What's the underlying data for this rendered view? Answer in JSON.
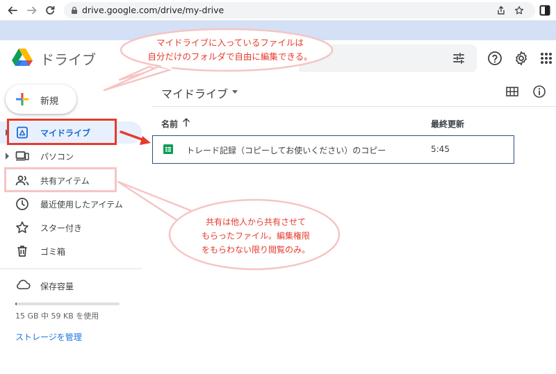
{
  "browser": {
    "url": "drive.google.com/drive/my-drive"
  },
  "header": {
    "app_name": "ドライブ"
  },
  "sidebar": {
    "new_button": "新規",
    "items": [
      {
        "label": "マイドライブ",
        "icon": "my-drive-icon"
      },
      {
        "label": "パソコン",
        "icon": "computer-icon"
      },
      {
        "label": "共有アイテム",
        "icon": "shared-people-icon"
      },
      {
        "label": "最近使用したアイテム",
        "icon": "clock-icon"
      },
      {
        "label": "スター付き",
        "icon": "star-icon"
      },
      {
        "label": "ゴミ箱",
        "icon": "trash-icon"
      }
    ],
    "storage": {
      "label": "保存容量",
      "usage": "15 GB 中 59 KB を使用",
      "used_fraction": 0.0,
      "manage_link": "ストレージを管理"
    }
  },
  "main": {
    "title": "マイドライブ",
    "columns": {
      "name": "名前",
      "modified": "最終更新"
    },
    "files": [
      {
        "name": "トレード記録（コピーしてお使いください）のコピー",
        "modified": "5:45",
        "icon": "google-sheets-icon"
      }
    ]
  },
  "annotations": {
    "callout_1": [
      "マイドライブに入っているファイルは",
      "自分だけのフォルダで自由に編集できる。"
    ],
    "callout_2": [
      "共有は他人から共有させて",
      "もらったファイル。編集権限",
      "をもらわない限り閲覧のみ。"
    ]
  },
  "colors": {
    "accent": "#1a73e8",
    "active_bg": "#e8f0fe",
    "annotation_red": "#e53a2c",
    "annotation_pink": "#f6c4c4",
    "browser_band": "#d3e0f5"
  }
}
